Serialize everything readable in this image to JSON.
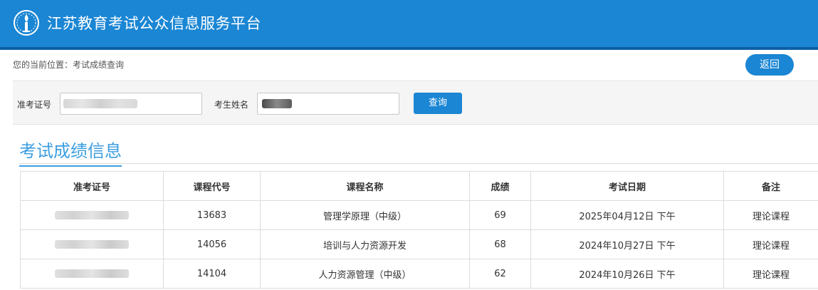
{
  "header": {
    "title": "江苏教育考试公众信息服务平台",
    "logo_icon": "torch-logo-icon",
    "bg_color": "#1a86d4"
  },
  "breadcrumb": {
    "text": "您的当前位置：考试成绩查询"
  },
  "back_button": {
    "label": "返回"
  },
  "search": {
    "ticket_label": "准考证号",
    "name_label": "考生姓名",
    "query_label": "查询"
  },
  "section": {
    "title": "考试成绩信息"
  },
  "table": {
    "columns": [
      "准考证号",
      "课程代号",
      "课程名称",
      "成绩",
      "考试日期",
      "备注"
    ],
    "rows": [
      {
        "course_code": "13683",
        "course_name": "管理学原理（中级）",
        "score": "69",
        "date": "2025年04月12日 下午",
        "remark": "理论课程"
      },
      {
        "course_code": "14056",
        "course_name": "培训与人力资源开发",
        "score": "68",
        "date": "2024年10月27日 下午",
        "remark": "理论课程"
      },
      {
        "course_code": "14104",
        "course_name": "人力资源管理（中级）",
        "score": "62",
        "date": "2024年10月26日 下午",
        "remark": "理论课程"
      }
    ]
  }
}
